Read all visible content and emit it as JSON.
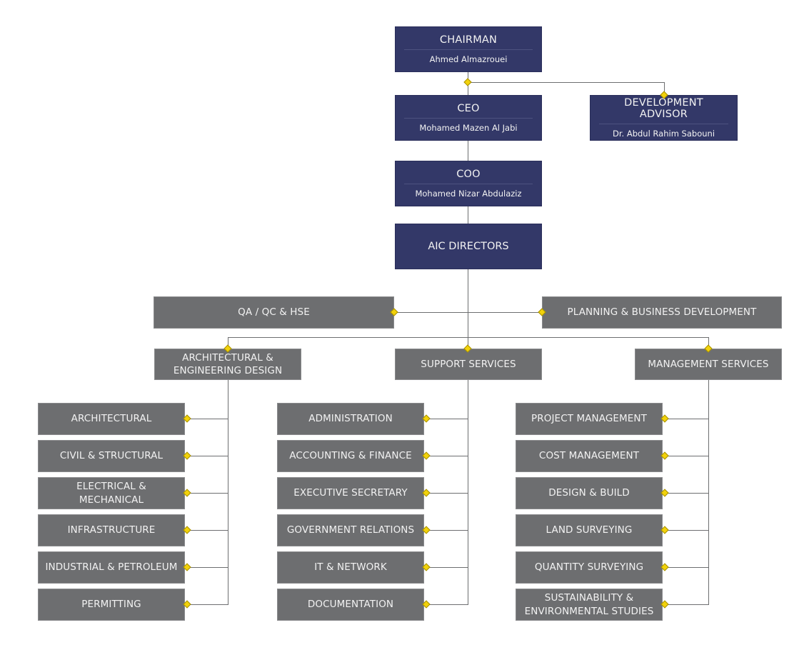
{
  "org_chart": {
    "colors": {
      "executive": "#333868",
      "department": "#6d6e70",
      "connector": "#6d6e70",
      "node_marker": "#f2d20b"
    },
    "chairman": {
      "title": "CHAIRMAN",
      "name": "Ahmed Almazrouei"
    },
    "ceo": {
      "title": "CEO",
      "name": "Mohamed Mazen Al Jabi"
    },
    "advisor": {
      "title": "DEVELOPMENT ADVISOR",
      "name": "Dr. Abdul Rahim Sabouni"
    },
    "coo": {
      "title": "COO",
      "name": "Mohamed Nizar Abdulaziz"
    },
    "directors": {
      "title": "AIC DIRECTORS"
    },
    "staff": {
      "left": "QA / QC & HSE",
      "right": "PLANNING & BUSINESS DEVELOPMENT"
    },
    "divisions": [
      {
        "title": "ARCHITECTURAL & ENGINEERING DESIGN",
        "units": [
          "ARCHITECTURAL",
          "CIVIL & STRUCTURAL",
          "ELECTRICAL & MECHANICAL",
          "INFRASTRUCTURE",
          "INDUSTRIAL & PETROLEUM",
          "PERMITTING"
        ]
      },
      {
        "title": "SUPPORT SERVICES",
        "units": [
          "ADMINISTRATION",
          "ACCOUNTING & FINANCE",
          "EXECUTIVE SECRETARY",
          "GOVERNMENT RELATIONS",
          "IT & NETWORK",
          "DOCUMENTATION"
        ]
      },
      {
        "title": "MANAGEMENT SERVICES",
        "units": [
          "PROJECT MANAGEMENT",
          "COST MANAGEMENT",
          "DESIGN & BUILD",
          "LAND SURVEYING",
          "QUANTITY SURVEYING",
          "SUSTAINABILITY & ENVIRONMENTAL STUDIES"
        ]
      }
    ]
  }
}
